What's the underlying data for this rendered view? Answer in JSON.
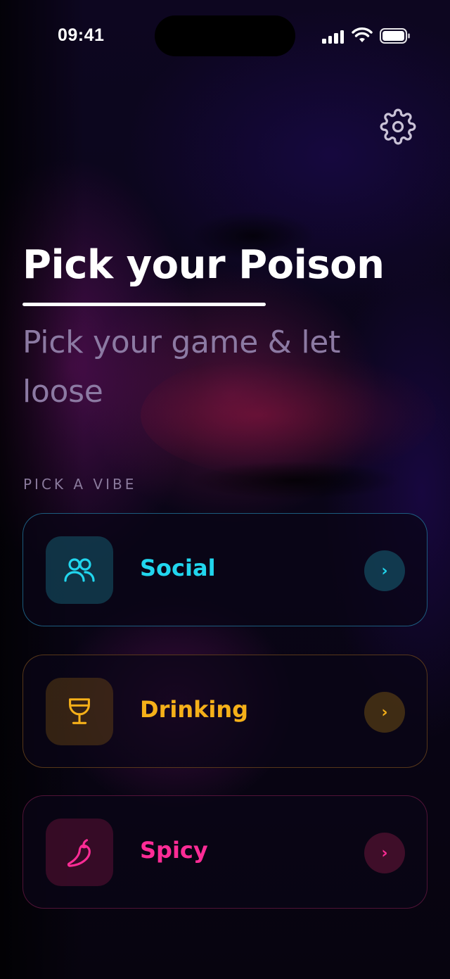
{
  "status_bar": {
    "time": "09:41"
  },
  "header": {
    "settings_icon": "gear-icon"
  },
  "hero": {
    "title": "Pick your Poison",
    "subtitle": "Pick your game & let loose"
  },
  "section": {
    "label": "PICK A VIBE"
  },
  "vibes": [
    {
      "label": "Social",
      "icon": "people-icon",
      "color": "#21d6ee",
      "arrow": "›"
    },
    {
      "label": "Drinking",
      "icon": "wine-glass-icon",
      "color": "#f5b019",
      "arrow": "›"
    },
    {
      "label": "Spicy",
      "icon": "chili-pepper-icon",
      "color": "#ff2c96",
      "arrow": "›"
    }
  ]
}
